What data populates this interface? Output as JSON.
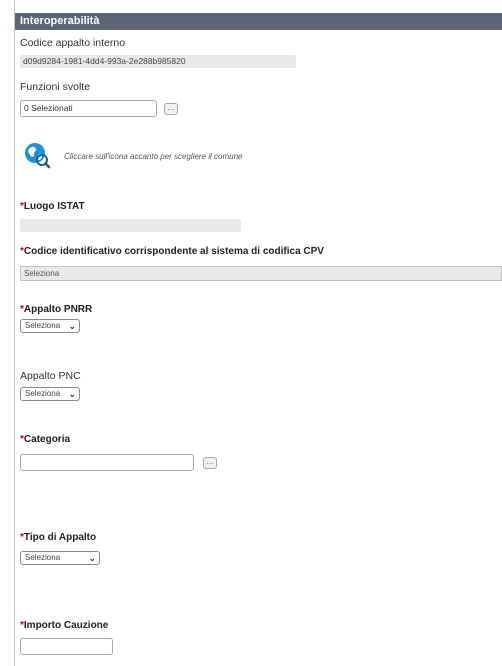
{
  "section": {
    "title": "Interoperabilità"
  },
  "codice_appalto": {
    "label": "Codice appalto interno",
    "value": "d09d9284-1981-4dd4-993a-2e288b985820"
  },
  "funzioni_svolte": {
    "label": "Funzioni svolte",
    "value": "0 Selezionati",
    "button": "..."
  },
  "comune": {
    "icon": "globe-search-icon",
    "hint": "Cliccare sull'icona accanto per scegliere il comune"
  },
  "luogo_istat": {
    "star": "*",
    "label": "Luogo ISTAT",
    "value": ""
  },
  "cpv": {
    "star": "*",
    "label": "Codice identificativo corrispondente al sistema di codifica CPV",
    "value": "Seleziona"
  },
  "appalto_pnrr": {
    "star": "*",
    "label": "Appalto PNRR",
    "value": "Seleziona"
  },
  "appalto_pnc": {
    "label": "Appalto PNC",
    "value": "Seleziona"
  },
  "categoria": {
    "star": "*",
    "label": "Categoria",
    "value": "",
    "button": "..."
  },
  "tipo_appalto": {
    "star": "*",
    "label": "Tipo di Appalto",
    "value": "Seleziona"
  },
  "importo_cauzione": {
    "star": "*",
    "label": "Importo Cauzione",
    "value": ""
  },
  "colors": {
    "header_bg": "#5a6578",
    "required_star": "#d00000",
    "readonly_bg": "#e8e8e8"
  }
}
